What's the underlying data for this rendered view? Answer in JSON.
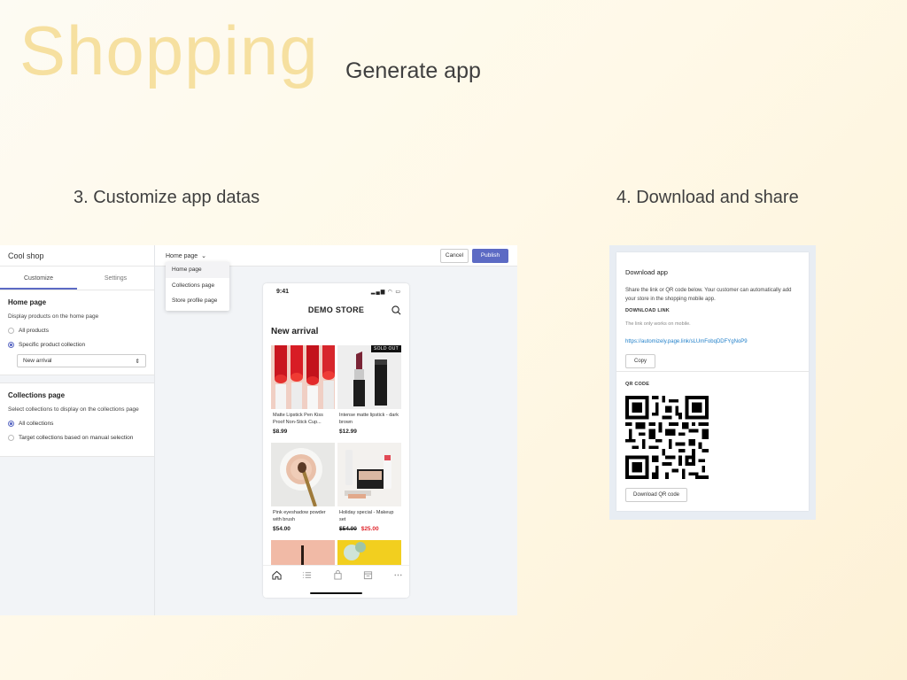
{
  "header": {
    "title": "Shopping",
    "subtitle": "Generate app"
  },
  "steps": {
    "customize": "3. Customize app datas",
    "download": "4. Download and share"
  },
  "editor": {
    "shop_name": "Cool shop",
    "tabs": [
      "Customize",
      "Settings"
    ],
    "home_card": {
      "title": "Home page",
      "description": "Display products on the home page",
      "options": [
        "All products",
        "Specific product collection"
      ],
      "selected_option": 1,
      "collection_select": "New arrival"
    },
    "collections_card": {
      "title": "Collections page",
      "description": "Select collections to display on the collections page",
      "options": [
        "All collections",
        "Target collections based on manual selection"
      ],
      "selected_option": 0
    },
    "page_select": "Home page",
    "dropdown_items": [
      "Home page",
      "Collections page",
      "Store profile page"
    ],
    "cancel_label": "Cancel",
    "publish_label": "Publish",
    "accent_color": "#5c6ac4"
  },
  "phone": {
    "time": "9:41",
    "store_name": "DEMO STORE",
    "section_title": "New arrival",
    "sold_out_label": "SOLD OUT",
    "products": [
      {
        "name": "Matte Lipstick Pen Kiss Proof Non-Stick Cup...",
        "price": "$8.99",
        "image": "red-lipsticks"
      },
      {
        "name": "Intense matte lipstick - dark brown",
        "price": "$12.99",
        "image": "lipstick-tube",
        "sold_out": true
      },
      {
        "name": "Pink eyeshadow powder with brush",
        "price": "$54.00",
        "image": "eyeshadow-brush"
      },
      {
        "name": "Holiday special - Makeup set",
        "old_price": "$54.00",
        "price": "$25.00",
        "image": "makeup-set"
      },
      {
        "name": "",
        "price": "",
        "image": "mascara-peach"
      },
      {
        "name": "",
        "price": "",
        "image": "flowers-yellow"
      }
    ],
    "nav_icons": [
      "home-icon",
      "list-icon",
      "bag-icon",
      "store-icon",
      "more-icon"
    ]
  },
  "download": {
    "title": "Download app",
    "description": "Share the link or QR code below. Your customer can automatically add your store in the shopping mobile app.",
    "link_label": "DOWNLOAD LINK",
    "link_help": "The link only works on mobile.",
    "link": "https://automizely.page.link/sLUmFobqDDFYgNoP9",
    "copy_label": "Copy",
    "qr_label": "QR CODE",
    "download_qr_label": "Download QR code"
  }
}
